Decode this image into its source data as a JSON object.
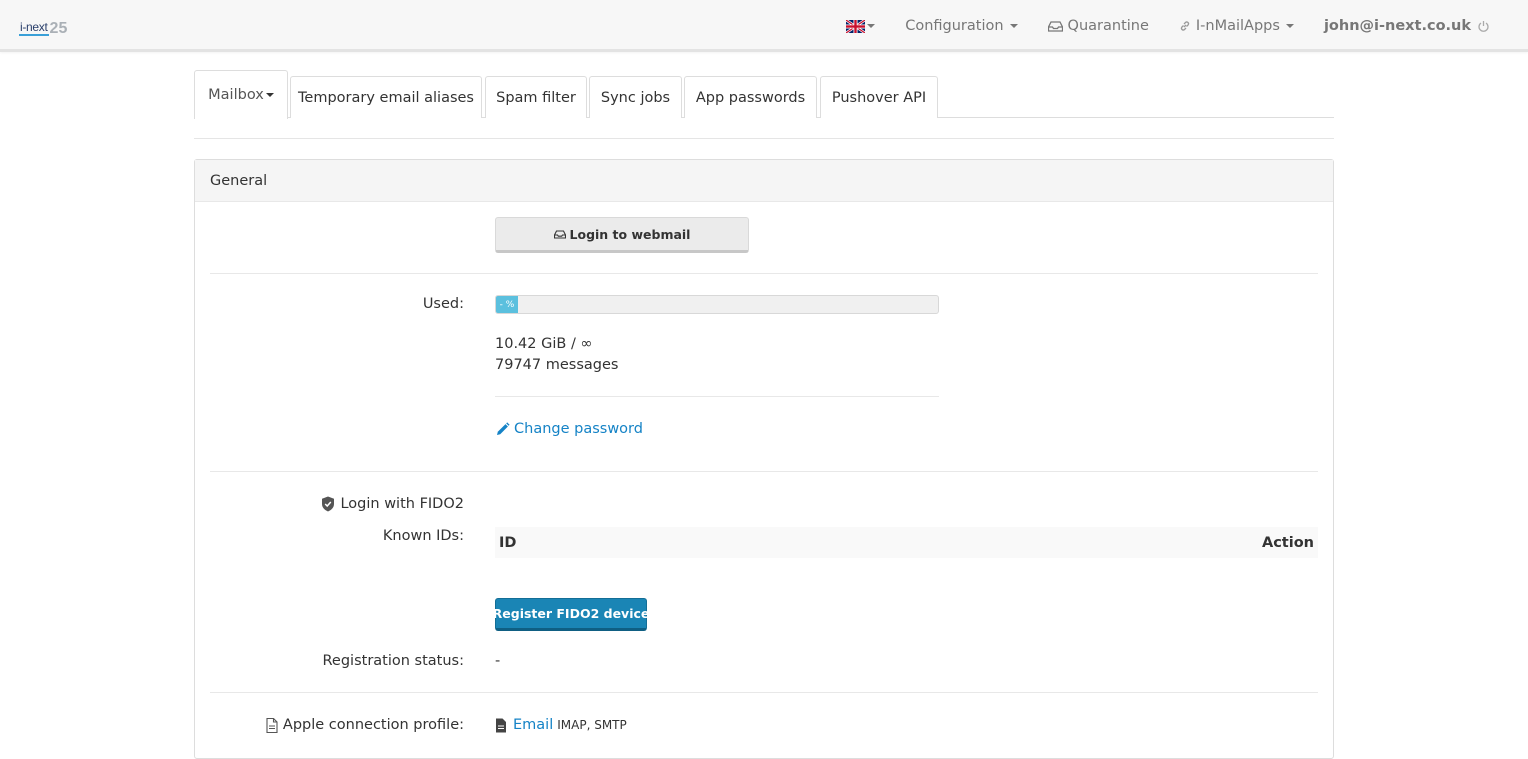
{
  "brand": {
    "name": "i-next",
    "number": "25"
  },
  "nav": {
    "configuration": "Configuration",
    "quarantine": "Quarantine",
    "apps": "I-nMailApps",
    "user": "john@i-next.co.uk"
  },
  "tabs": [
    {
      "label": "Mailbox"
    },
    {
      "label": "Temporary email aliases"
    },
    {
      "label": "Spam filter"
    },
    {
      "label": "Sync jobs"
    },
    {
      "label": "App passwords"
    },
    {
      "label": "Pushover API"
    }
  ],
  "panel": {
    "heading": "General",
    "webmail_button": "Login to webmail",
    "used_label": "Used:",
    "progress_text": "- %",
    "progress_fraction": 0.05,
    "usage": "10.42 GiB / ∞",
    "messages": "79747 messages",
    "change_password": "Change password",
    "fido_label": "Login with FIDO2",
    "known_ids_label": "Known IDs:",
    "table_id": "ID",
    "table_action": "Action",
    "register_button": "Register FIDO2 device",
    "registration_label": "Registration status:",
    "registration_value": "-",
    "apple_label": "Apple connection profile:",
    "apple_link": "Email",
    "apple_protocols": "IMAP, SMTP"
  },
  "colors": {
    "link": "#1583c6",
    "primary_button": "#1a85b5",
    "progress": "#5bc0de"
  }
}
